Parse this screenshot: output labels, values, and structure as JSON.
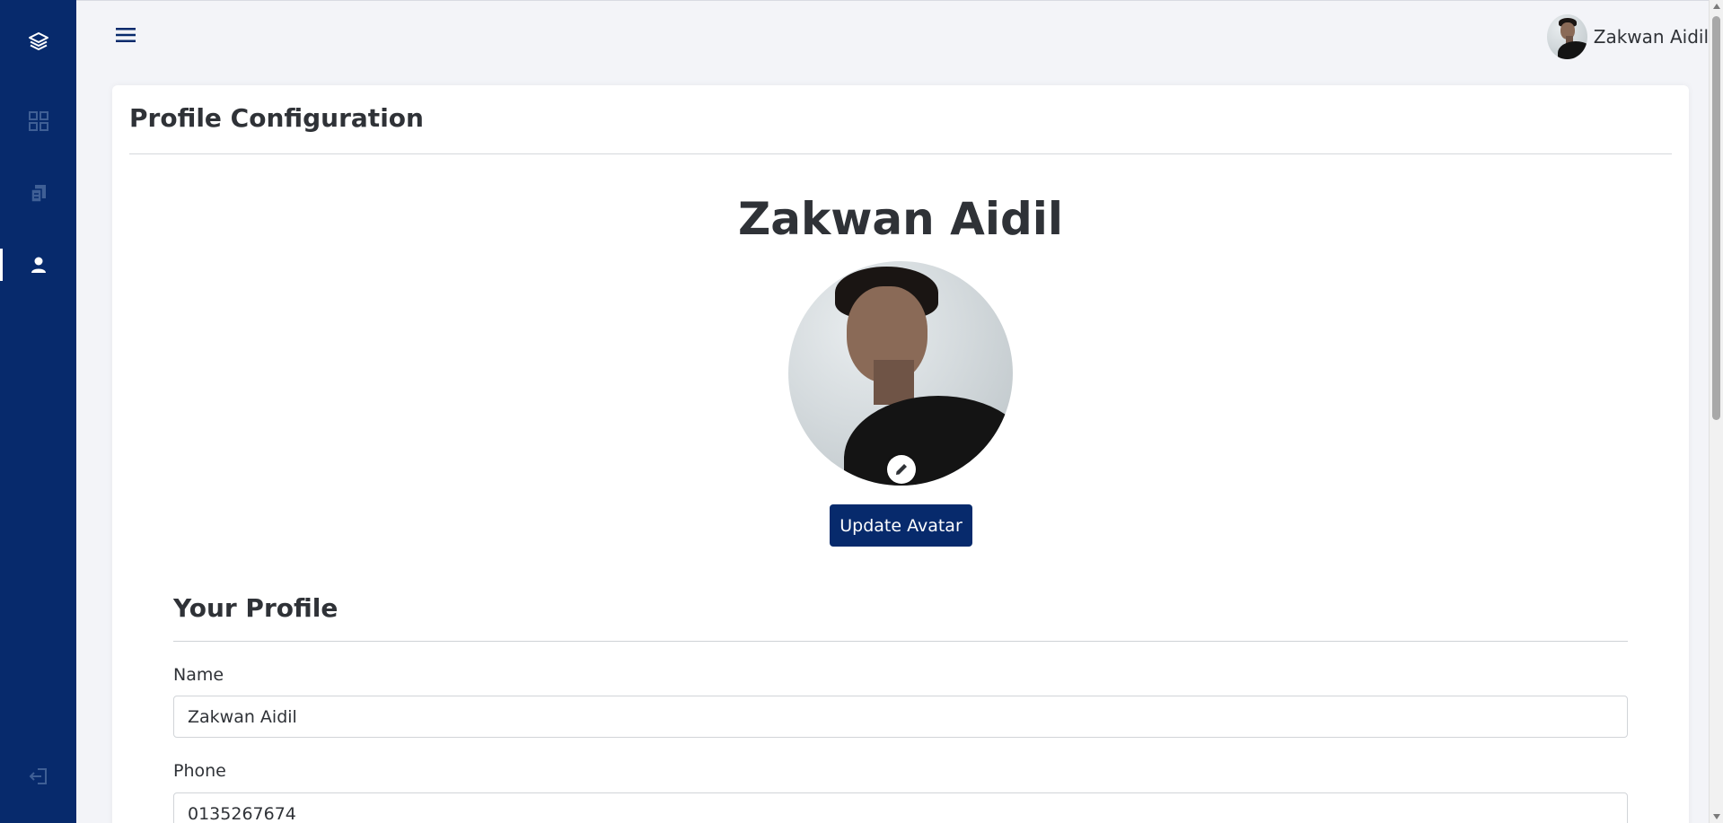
{
  "header": {
    "user_name": "Zakwan Aidil"
  },
  "page": {
    "title": "Profile Configuration"
  },
  "profile": {
    "display_name": "Zakwan Aidil",
    "update_avatar_label": "Update Avatar"
  },
  "section": {
    "title": "Your Profile"
  },
  "form": {
    "name_label": "Name",
    "name_value": "Zakwan Aidil",
    "phone_label": "Phone",
    "phone_value": "0135267674"
  },
  "colors": {
    "sidebar": "#072a6c",
    "primary_button": "#072a6c",
    "page_background": "#f3f4f8"
  },
  "icons": {
    "logo": "layers-icon",
    "dashboard": "grid-icon",
    "documents": "document-icon",
    "profile": "user-icon",
    "logout": "logout-icon",
    "menu": "hamburger-icon",
    "edit": "pencil-icon"
  }
}
